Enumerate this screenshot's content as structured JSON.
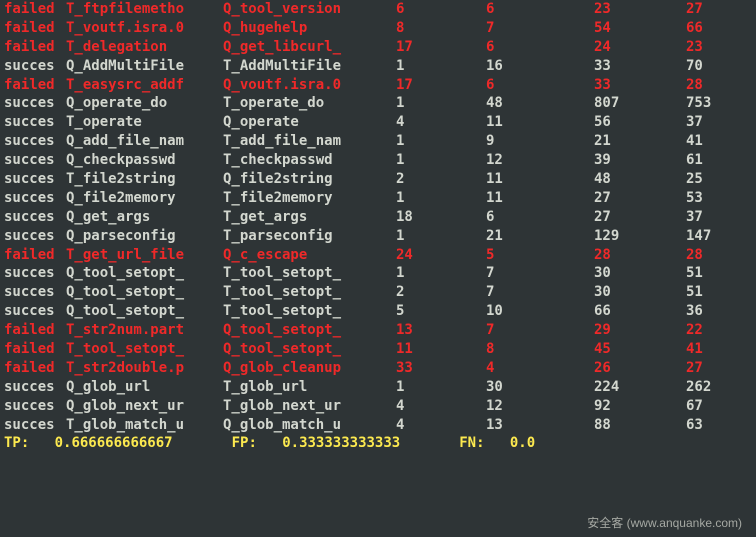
{
  "rows": [
    {
      "status": "failed",
      "name1": "T_ftpfilemetho",
      "name2": "Q_tool_version",
      "v1": "6",
      "v2": "6",
      "v3": "23",
      "v4": "27"
    },
    {
      "status": "failed",
      "name1": "T_voutf.isra.0",
      "name2": "Q_hugehelp",
      "v1": "8",
      "v2": "7",
      "v3": "54",
      "v4": "66"
    },
    {
      "status": "failed",
      "name1": "T_delegation",
      "name2": "Q_get_libcurl_",
      "v1": "17",
      "v2": "6",
      "v3": "24",
      "v4": "23"
    },
    {
      "status": "succes",
      "name1": "Q_AddMultiFile",
      "name2": "T_AddMultiFile",
      "v1": "1",
      "v2": "16",
      "v3": "33",
      "v4": "70"
    },
    {
      "status": "failed",
      "name1": "T_easysrc_addf",
      "name2": "Q_voutf.isra.0",
      "v1": "17",
      "v2": "6",
      "v3": "33",
      "v4": "28"
    },
    {
      "status": "succes",
      "name1": "Q_operate_do",
      "name2": "T_operate_do",
      "v1": "1",
      "v2": "48",
      "v3": "807",
      "v4": "753"
    },
    {
      "status": "succes",
      "name1": "T_operate",
      "name2": "Q_operate",
      "v1": "4",
      "v2": "11",
      "v3": "56",
      "v4": "37"
    },
    {
      "status": "succes",
      "name1": "Q_add_file_nam",
      "name2": "T_add_file_nam",
      "v1": "1",
      "v2": "9",
      "v3": "21",
      "v4": "41"
    },
    {
      "status": "succes",
      "name1": "Q_checkpasswd",
      "name2": "T_checkpasswd",
      "v1": "1",
      "v2": "12",
      "v3": "39",
      "v4": "61"
    },
    {
      "status": "succes",
      "name1": "T_file2string",
      "name2": "Q_file2string",
      "v1": "2",
      "v2": "11",
      "v3": "48",
      "v4": "25"
    },
    {
      "status": "succes",
      "name1": "Q_file2memory",
      "name2": "T_file2memory",
      "v1": "1",
      "v2": "11",
      "v3": "27",
      "v4": "53"
    },
    {
      "status": "succes",
      "name1": "Q_get_args",
      "name2": "T_get_args",
      "v1": "18",
      "v2": "6",
      "v3": "27",
      "v4": "37"
    },
    {
      "status": "succes",
      "name1": "Q_parseconfig",
      "name2": "T_parseconfig",
      "v1": "1",
      "v2": "21",
      "v3": "129",
      "v4": "147"
    },
    {
      "status": "failed",
      "name1": "T_get_url_file",
      "name2": "Q_c_escape",
      "v1": "24",
      "v2": "5",
      "v3": "28",
      "v4": "28"
    },
    {
      "status": "succes",
      "name1": "Q_tool_setopt_",
      "name2": "T_tool_setopt_",
      "v1": "1",
      "v2": "7",
      "v3": "30",
      "v4": "51"
    },
    {
      "status": "succes",
      "name1": "Q_tool_setopt_",
      "name2": "T_tool_setopt_",
      "v1": "2",
      "v2": "7",
      "v3": "30",
      "v4": "51"
    },
    {
      "status": "succes",
      "name1": "Q_tool_setopt_",
      "name2": "T_tool_setopt_",
      "v1": "5",
      "v2": "10",
      "v3": "66",
      "v4": "36"
    },
    {
      "status": "failed",
      "name1": "T_str2num.part",
      "name2": "Q_tool_setopt_",
      "v1": "13",
      "v2": "7",
      "v3": "29",
      "v4": "22"
    },
    {
      "status": "failed",
      "name1": "T_tool_setopt_",
      "name2": "Q_tool_setopt_",
      "v1": "11",
      "v2": "8",
      "v3": "45",
      "v4": "41"
    },
    {
      "status": "failed",
      "name1": "T_str2double.p",
      "name2": "Q_glob_cleanup",
      "v1": "33",
      "v2": "4",
      "v3": "26",
      "v4": "27"
    },
    {
      "status": "succes",
      "name1": "Q_glob_url",
      "name2": "T_glob_url",
      "v1": "1",
      "v2": "30",
      "v3": "224",
      "v4": "262"
    },
    {
      "status": "succes",
      "name1": "Q_glob_next_ur",
      "name2": "T_glob_next_ur",
      "v1": "4",
      "v2": "12",
      "v3": "92",
      "v4": "67"
    },
    {
      "status": "succes",
      "name1": "T_glob_match_u",
      "name2": "Q_glob_match_u",
      "v1": "4",
      "v2": "13",
      "v3": "88",
      "v4": "63"
    }
  ],
  "summary": {
    "tp_label": "TP:",
    "tp_value": "0.666666666667",
    "fp_label": "FP:",
    "fp_value": "0.333333333333",
    "fn_label": "FN:",
    "fn_value": "0.0"
  },
  "watermark": {
    "brand": "安全客",
    "url": "www.anquanke.com"
  }
}
